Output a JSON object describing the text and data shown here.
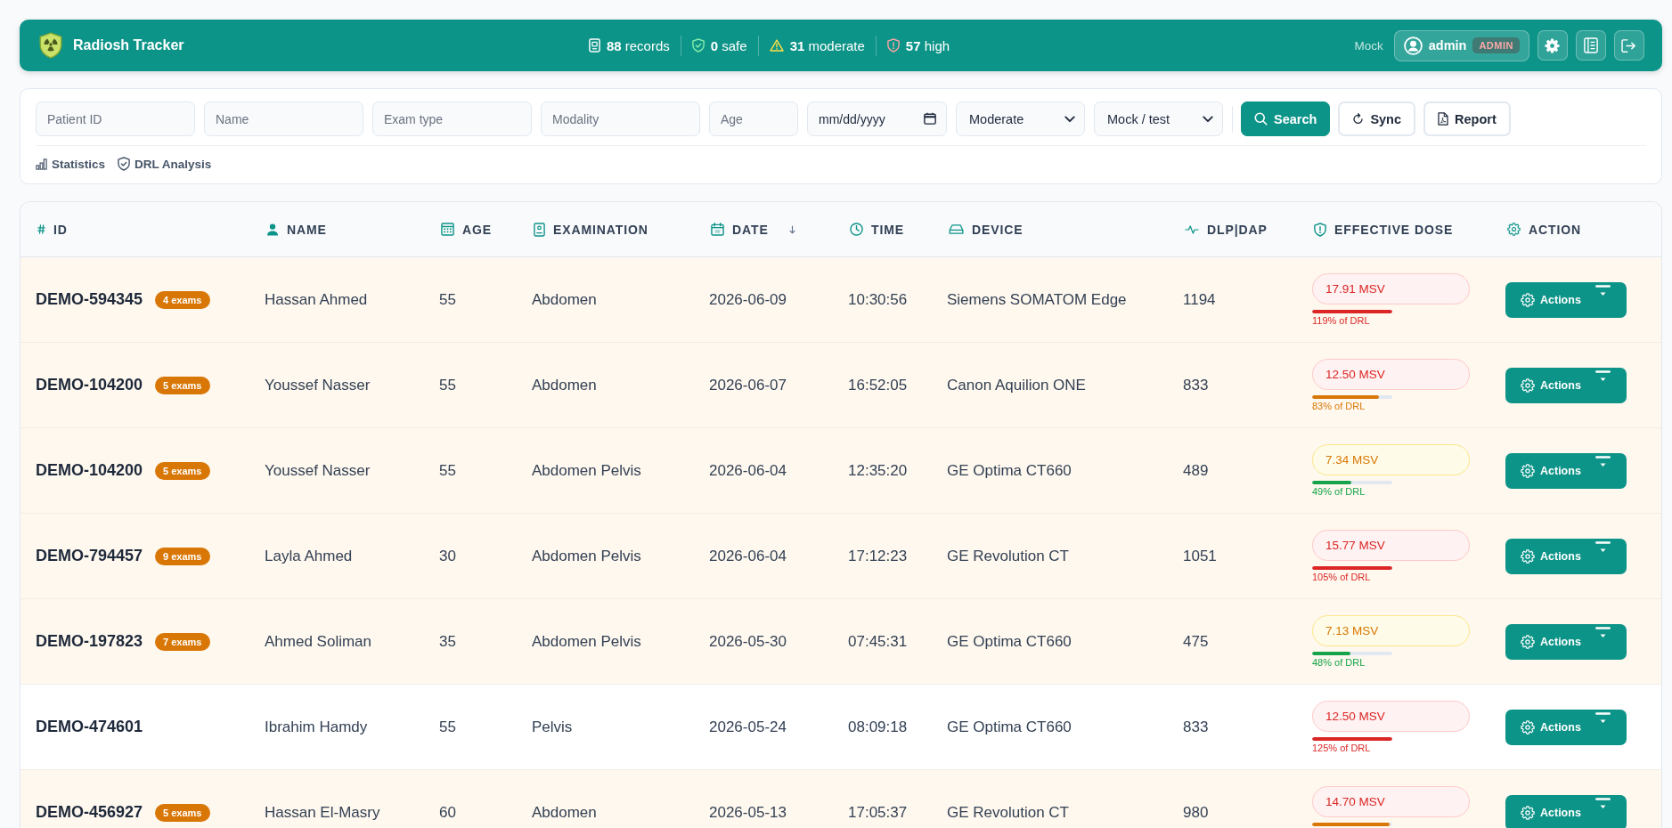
{
  "header": {
    "title": "Radiosh Tracker",
    "stats": [
      {
        "kind": "records",
        "value": "88",
        "label": "records"
      },
      {
        "kind": "safe",
        "value": "0",
        "label": "safe"
      },
      {
        "kind": "moderate",
        "value": "31",
        "label": "moderate"
      },
      {
        "kind": "high",
        "value": "57",
        "label": "high"
      }
    ],
    "mode": "Mock",
    "user": {
      "name": "admin",
      "role": "ADMIN"
    }
  },
  "filters": {
    "fields": [
      {
        "placeholder": "Patient ID"
      },
      {
        "placeholder": "Name"
      },
      {
        "placeholder": "Exam type"
      },
      {
        "placeholder": "Modality"
      },
      {
        "placeholder": "Age"
      }
    ],
    "date": {
      "placeholder": "mm/dd/yyyy"
    },
    "selects": [
      {
        "value": "Moderate"
      },
      {
        "value": "Mock / test"
      }
    ],
    "buttons": [
      {
        "kind": "search",
        "label": "Search"
      },
      {
        "kind": "sync",
        "label": "Sync"
      },
      {
        "kind": "report",
        "label": "Report"
      }
    ],
    "links": [
      {
        "kind": "statistics",
        "label": "Statistics"
      },
      {
        "kind": "drl",
        "label": "DRL Analysis"
      }
    ]
  },
  "table": {
    "columns": [
      {
        "kind": "id",
        "label": "ID",
        "sorted": false
      },
      {
        "kind": "name",
        "label": "NAME",
        "sorted": false
      },
      {
        "kind": "age",
        "label": "AGE",
        "sorted": false
      },
      {
        "kind": "examination",
        "label": "EXAMINATION",
        "sorted": false
      },
      {
        "kind": "date",
        "label": "DATE",
        "sorted": true
      },
      {
        "kind": "time",
        "label": "TIME",
        "sorted": false
      },
      {
        "kind": "device",
        "label": "DEVICE",
        "sorted": false
      },
      {
        "kind": "dlp",
        "label": "DLP|DAP",
        "sorted": false
      },
      {
        "kind": "dose",
        "label": "EFFECTIVE DOSE",
        "sorted": false
      },
      {
        "kind": "action",
        "label": "ACTION",
        "sorted": false
      }
    ],
    "rows": [
      {
        "highlighted": true,
        "patient_id": "DEMO-594345",
        "exams": "4 exams",
        "name": "Hassan Ahmed",
        "age": "55",
        "examination": "Abdomen",
        "date": "2026-06-09",
        "time": "10:30:56",
        "device": "Siemens SOMATOM Edge",
        "dlp": "1194",
        "dose": {
          "kind": "high",
          "value": "17.91 MSV",
          "level": 1,
          "drl": "119% of DRL"
        },
        "action": "Actions"
      },
      {
        "highlighted": true,
        "patient_id": "DEMO-104200",
        "exams": "5 exams",
        "name": "Youssef Nasser",
        "age": "55",
        "examination": "Abdomen",
        "date": "2026-06-07",
        "time": "16:52:05",
        "device": "Canon Aquilion ONE",
        "dlp": "833",
        "dose": {
          "kind": "high",
          "value": "12.50 MSV",
          "level": 0.83,
          "drl": "83% of DRL"
        },
        "action": "Actions"
      },
      {
        "highlighted": true,
        "patient_id": "DEMO-104200",
        "exams": "5 exams",
        "name": "Youssef Nasser",
        "age": "55",
        "examination": "Abdomen Pelvis",
        "date": "2026-06-04",
        "time": "12:35:20",
        "device": "GE Optima CT660",
        "dlp": "489",
        "dose": {
          "kind": "moderate",
          "value": "7.34 MSV",
          "level": 0.49,
          "drl": "49% of DRL"
        },
        "action": "Actions"
      },
      {
        "highlighted": true,
        "patient_id": "DEMO-794457",
        "exams": "9 exams",
        "name": "Layla Ahmed",
        "age": "30",
        "examination": "Abdomen Pelvis",
        "date": "2026-06-04",
        "time": "17:12:23",
        "device": "GE Revolution CT",
        "dlp": "1051",
        "dose": {
          "kind": "high",
          "value": "15.77 MSV",
          "level": 1,
          "drl": "105% of DRL"
        },
        "action": "Actions"
      },
      {
        "highlighted": true,
        "patient_id": "DEMO-197823",
        "exams": "7 exams",
        "name": "Ahmed Soliman",
        "age": "35",
        "examination": "Abdomen Pelvis",
        "date": "2026-05-30",
        "time": "07:45:31",
        "device": "GE Optima CT660",
        "dlp": "475",
        "dose": {
          "kind": "moderate",
          "value": "7.13 MSV",
          "level": 0.48,
          "drl": "48% of DRL"
        },
        "action": "Actions"
      },
      {
        "highlighted": false,
        "patient_id": "DEMO-474601",
        "name": "Ibrahim Hamdy",
        "age": "55",
        "examination": "Pelvis",
        "date": "2026-05-24",
        "time": "08:09:18",
        "device": "GE Optima CT660",
        "dlp": "833",
        "dose": {
          "kind": "high",
          "value": "12.50 MSV",
          "level": 1,
          "drl": "125% of DRL"
        },
        "action": "Actions"
      },
      {
        "highlighted": true,
        "patient_id": "DEMO-456927",
        "exams": "5 exams",
        "name": "Hassan El-Masry",
        "age": "60",
        "examination": "Abdomen",
        "date": "2026-05-13",
        "time": "17:05:37",
        "device": "GE Revolution CT",
        "dlp": "980",
        "dose": {
          "kind": "high",
          "value": "14.70 MSV",
          "level": 0.97
        },
        "action": "Actions"
      }
    ]
  }
}
